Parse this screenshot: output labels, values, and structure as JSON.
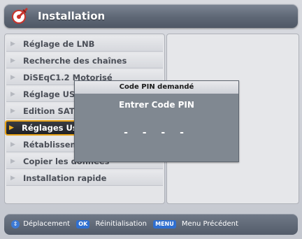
{
  "header": {
    "title": "Installation",
    "icon": "pen-tool-icon"
  },
  "menu": {
    "items": [
      {
        "label": "Réglage de LNB"
      },
      {
        "label": "Recherche des chaînes"
      },
      {
        "label": "DiSEqC1.2 Motorisé"
      },
      {
        "label": "Réglage USA"
      },
      {
        "label": "Edition SAT o"
      },
      {
        "label": "Réglages Usi"
      },
      {
        "label": "Rétablisseme"
      },
      {
        "label": "Copier les données"
      },
      {
        "label": "Installation rapide"
      }
    ],
    "selected_index": 5
  },
  "dialog": {
    "title": "Code PIN demandé",
    "prompt": "Entrer Code PIN",
    "pin_placeholder": "- - - -"
  },
  "footer": {
    "nav_label": "Déplacement",
    "ok_key": "OK",
    "ok_label": "Réinitialisation",
    "menu_key": "MENU",
    "menu_label": "Menu Précédent"
  },
  "colors": {
    "accent": "#e8a317",
    "key_blue": "#2f6fd0",
    "header_bg": "#5e6775"
  }
}
